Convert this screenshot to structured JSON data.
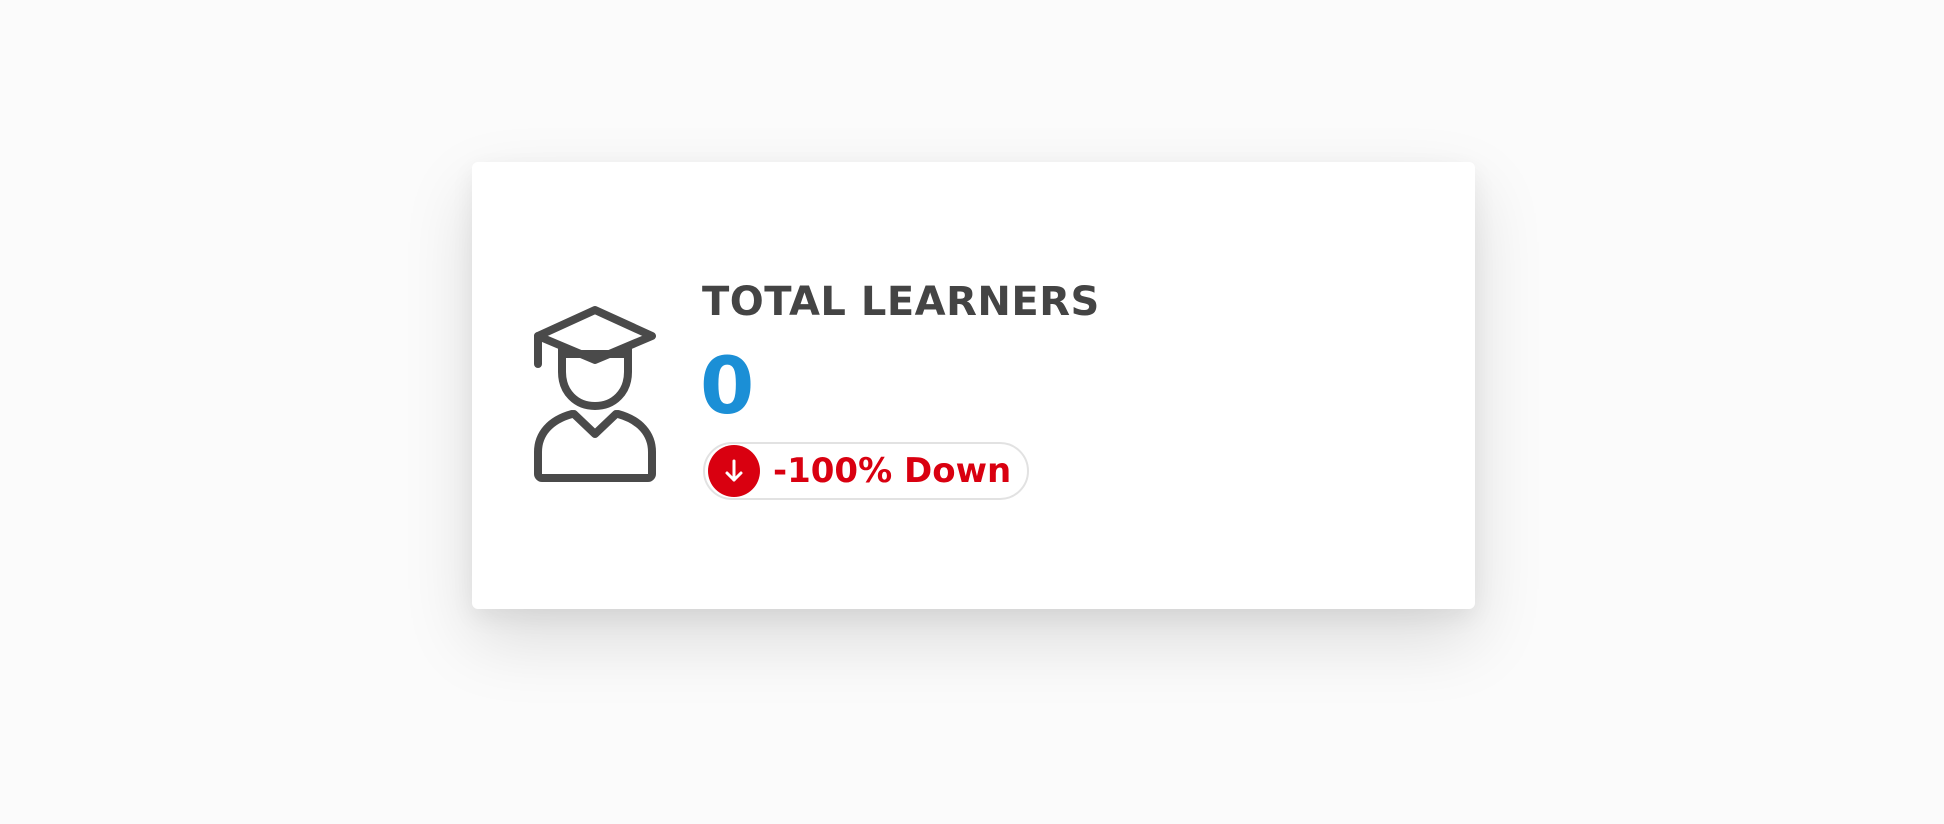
{
  "card": {
    "title": "TOTAL LEARNERS",
    "value": "0",
    "trend": {
      "text": "-100% Down",
      "direction": "down",
      "icon": "arrow-down-icon"
    },
    "icon": "graduate-icon"
  },
  "colors": {
    "background": "#fbfbfb",
    "card": "#ffffff",
    "title": "#444444",
    "value": "#1b8fd6",
    "trend_down": "#d90010",
    "icon_stroke": "#4a4a4a"
  }
}
